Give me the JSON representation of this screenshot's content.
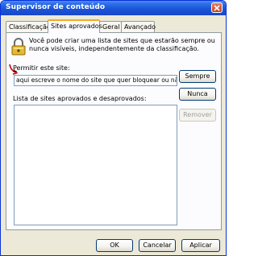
{
  "window": {
    "title": "Supervisor de conteúdo"
  },
  "tabs": [
    {
      "label": "Classificação",
      "active": false
    },
    {
      "label": "Sites aprovados",
      "active": true
    },
    {
      "label": "Geral",
      "active": false
    },
    {
      "label": "Avançado",
      "active": false
    }
  ],
  "panel": {
    "description": "Você pode criar uma lista de sites que estarão sempre ou nunca visíveis, independentemente da classificação.",
    "allow_label_prefix": "P",
    "allow_label_rest": "ermitir este site:",
    "site_input_value": "aqui escreve o nome do site que quer bloquear ou não",
    "always_button": "Sempre",
    "never_button": "Nunca",
    "list_label": "Lista de sites aprovados e desaprovados:",
    "remove_button": "Remover"
  },
  "footer": {
    "ok_button": "OK",
    "cancel_button": "Cancelar",
    "apply_button": "Aplicar"
  },
  "colors": {
    "titlebar": "#1a55d8",
    "annotation_arrow": "#c0181a",
    "tab_highlight": "#f6a72a"
  }
}
